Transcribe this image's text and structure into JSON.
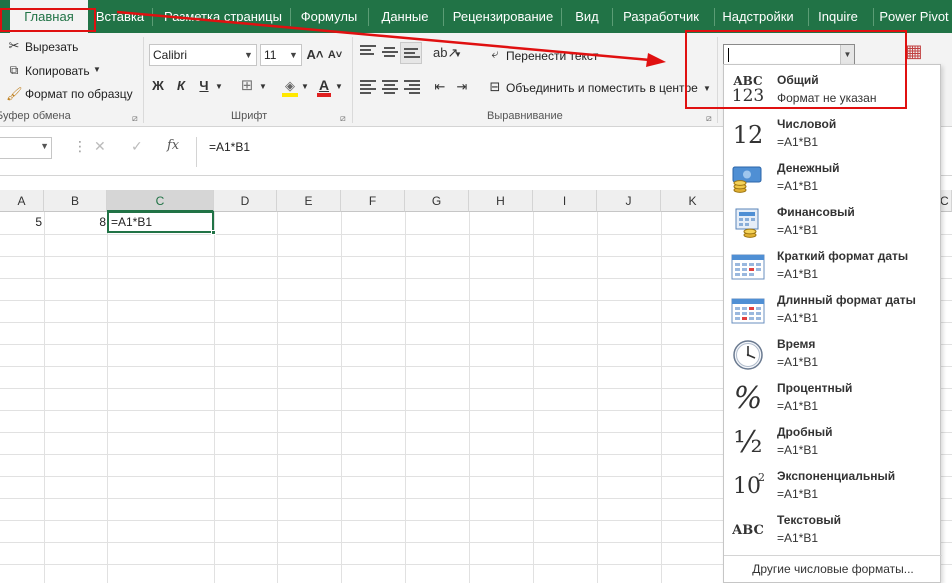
{
  "tabs": [
    {
      "label": "Главная",
      "active": true
    },
    {
      "label": "Вставка"
    },
    {
      "label": "Разметка страницы"
    },
    {
      "label": "Формулы"
    },
    {
      "label": "Данные"
    },
    {
      "label": "Рецензирование"
    },
    {
      "label": "Вид"
    },
    {
      "label": "Разработчик"
    },
    {
      "label": "Надстройки"
    },
    {
      "label": "Inquire"
    },
    {
      "label": "Power Pivot"
    }
  ],
  "clipboard": {
    "cut": "Вырезать",
    "copy": "Копировать",
    "format_painter": "Формат по образцу",
    "group_label": "Буфер обмена"
  },
  "font": {
    "name": "Calibri",
    "size": "11",
    "bold": "Ж",
    "italic": "К",
    "underline": "Ч",
    "group_label": "Шрифт"
  },
  "alignment": {
    "wrap_text": "Перенести текст",
    "merge_center": "Объединить и поместить в центре",
    "group_label": "Выравнивание"
  },
  "formula_bar": {
    "content": "=A1*B1",
    "fx": "fx"
  },
  "grid": {
    "columns": [
      "A",
      "B",
      "C",
      "D",
      "E",
      "F",
      "G",
      "H",
      "I",
      "J",
      "K",
      "C"
    ],
    "cells": {
      "A1": "5",
      "B1": "8",
      "C1": "=A1*B1"
    }
  },
  "number_formats": [
    {
      "name": "Общий",
      "sample": "Формат не указан",
      "icon": "general-abc123-icon"
    },
    {
      "name": "Числовой",
      "sample": "=A1*B1",
      "icon": "number-12-icon"
    },
    {
      "name": "Денежный",
      "sample": "=A1*B1",
      "icon": "currency-icon"
    },
    {
      "name": "Финансовый",
      "sample": " =A1*B1",
      "icon": "accounting-icon"
    },
    {
      "name": "Краткий формат даты",
      "sample": "=A1*B1",
      "icon": "calendar-short-icon"
    },
    {
      "name": "Длинный формат даты",
      "sample": "=A1*B1",
      "icon": "calendar-long-icon"
    },
    {
      "name": "Время",
      "sample": "=A1*B1",
      "icon": "clock-icon"
    },
    {
      "name": "Процентный",
      "sample": "=A1*B1",
      "icon": "percent-icon"
    },
    {
      "name": "Дробный",
      "sample": "=A1*B1",
      "icon": "fraction-icon"
    },
    {
      "name": "Экспоненциальный",
      "sample": "=A1*B1",
      "icon": "scientific-icon"
    },
    {
      "name": "Текстовый",
      "sample": "=A1*B1",
      "icon": "text-abc-icon"
    }
  ],
  "more_formats": "Другие числовые форматы...",
  "icon_text": {
    "general_top": "ABC",
    "general_bottom": "123",
    "number": "12",
    "percent": "%",
    "fraction": "½",
    "scientific_base": "10",
    "scientific_exp": "2",
    "text": "ABC"
  },
  "colors": {
    "ribbon_green": "#217346",
    "annotation_red": "#e01010",
    "highlight_yellow": "#ffe800",
    "font_red": "#e02020"
  }
}
